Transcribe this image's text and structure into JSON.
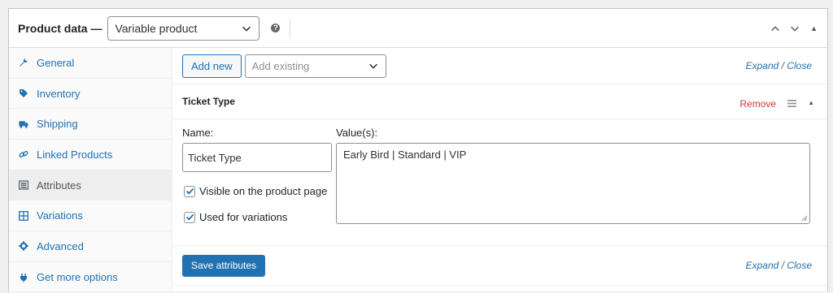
{
  "header": {
    "title": "Product data —",
    "product_type": "Variable product",
    "help_icon": "question-icon"
  },
  "sidebar": {
    "items": [
      {
        "label": "General",
        "icon": "wrench-icon",
        "active": false
      },
      {
        "label": "Inventory",
        "icon": "tag-icon",
        "active": false
      },
      {
        "label": "Shipping",
        "icon": "truck-icon",
        "active": false
      },
      {
        "label": "Linked Products",
        "icon": "link-icon",
        "active": false
      },
      {
        "label": "Attributes",
        "icon": "list-icon",
        "active": true
      },
      {
        "label": "Variations",
        "icon": "grid-icon",
        "active": false
      },
      {
        "label": "Advanced",
        "icon": "gear-icon",
        "active": false
      },
      {
        "label": "Get more options",
        "icon": "plugin-icon",
        "active": false
      }
    ]
  },
  "toolbar": {
    "add_new_label": "Add new",
    "add_existing_placeholder": "Add existing",
    "expand_label": "Expand",
    "slash": "/",
    "close_label": "Close"
  },
  "attribute": {
    "title": "Ticket Type",
    "remove_label": "Remove",
    "name_label": "Name:",
    "name_value": "Ticket Type",
    "values_label": "Value(s):",
    "values_value": "Early Bird | Standard | VIP",
    "visible_label": "Visible on the product page",
    "visible_checked": true,
    "variations_label": "Used for variations",
    "variations_checked": true
  },
  "footer": {
    "save_label": "Save attributes",
    "expand_label": "Expand",
    "slash": "/",
    "close_label": "Close"
  },
  "colors": {
    "accent": "#2271b1",
    "danger": "#d63638",
    "border": "#8c8f94"
  }
}
